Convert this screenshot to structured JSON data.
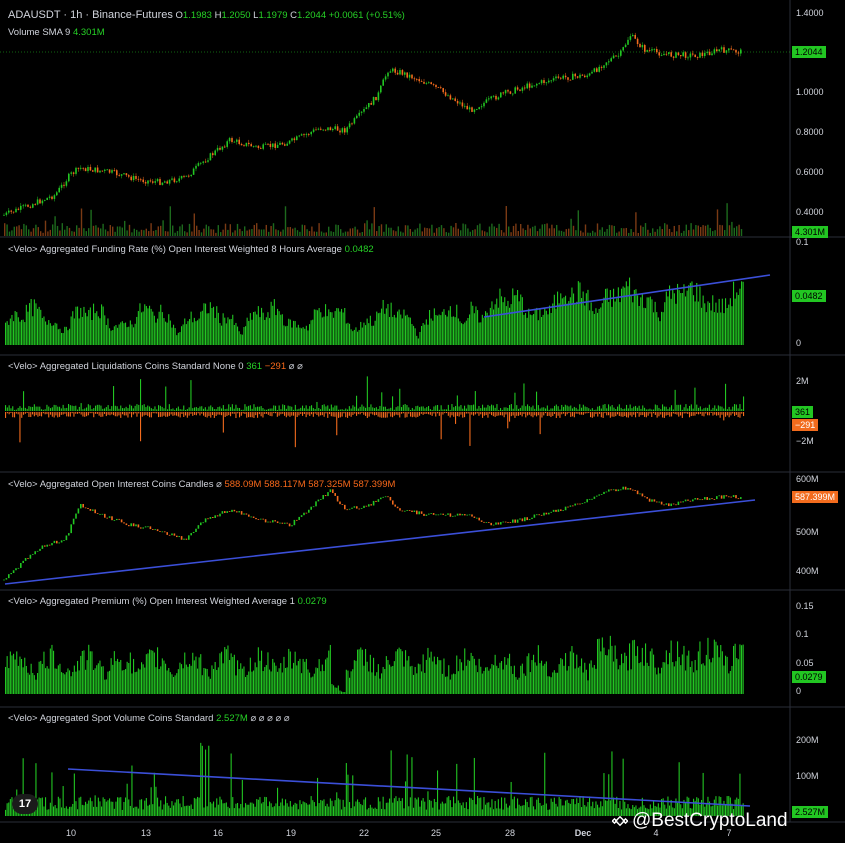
{
  "header": {
    "symbol": "ADAUSDT · 1h · Binance-Futures",
    "ohlc_o_label": "O",
    "ohlc_o": "1.1983",
    "ohlc_h_label": "H",
    "ohlc_h": "1.2050",
    "ohlc_l_label": "L",
    "ohlc_l": "1.1979",
    "ohlc_c_label": "C",
    "ohlc_c": "1.2044",
    "change": "+0.0061 (+0.51%)",
    "volume_label": "Volume SMA 9",
    "volume_value": "4.301M"
  },
  "price_pane": {
    "y_ticks": [
      "1.4000",
      "1.0000",
      "0.8000",
      "0.6000",
      "0.4000"
    ],
    "last_price_tag": "1.2044",
    "volume_tag": "4.301M"
  },
  "funding_pane": {
    "title": "<Velo> Aggregated Funding Rate (%) Open Interest Weighted 8 Hours Average",
    "value": "0.0482",
    "y_ticks": [
      "0.1",
      "0"
    ],
    "tag": "0.0482"
  },
  "liquidations_pane": {
    "title": "<Velo> Aggregated Liquidations Coins Standard None 0",
    "value_long": "361",
    "value_short": "−291",
    "icons": "⌀ ⌀",
    "y_ticks": [
      "2M",
      "−2M"
    ],
    "tag_green": "361",
    "tag_orange": "−291"
  },
  "oi_pane": {
    "title": "<Velo> Aggregated Open Interest Coins Candles",
    "icon": "⌀",
    "values": "588.09M 588.117M 587.325M 587.399M",
    "y_ticks": [
      "600M",
      "500M",
      "400M"
    ],
    "tag": "587.399M"
  },
  "premium_pane": {
    "title": "<Velo> Aggregated Premium (%) Open Interest Weighted Average 1",
    "value": "0.0279",
    "y_ticks": [
      "0.15",
      "0.1",
      "0.05",
      "0"
    ],
    "tag": "0.0279"
  },
  "spot_pane": {
    "title": "<Velo> Aggregated Spot Volume Coins Standard",
    "value": "2.527M",
    "icons": "⌀ ⌀ ⌀ ⌀ ⌀",
    "y_ticks": [
      "200M",
      "100M"
    ],
    "tag": "2.527M"
  },
  "x_axis": [
    "10",
    "13",
    "16",
    "19",
    "22",
    "25",
    "28",
    "Dec",
    "4",
    "7"
  ],
  "watermark": "@BestCryptoLand",
  "tv_logo": "17",
  "colors": {
    "background": "#000000",
    "up": "#22c622",
    "down": "#f26b1d",
    "trendline": "#3b4fd8",
    "text": "#d1d4dc"
  }
}
